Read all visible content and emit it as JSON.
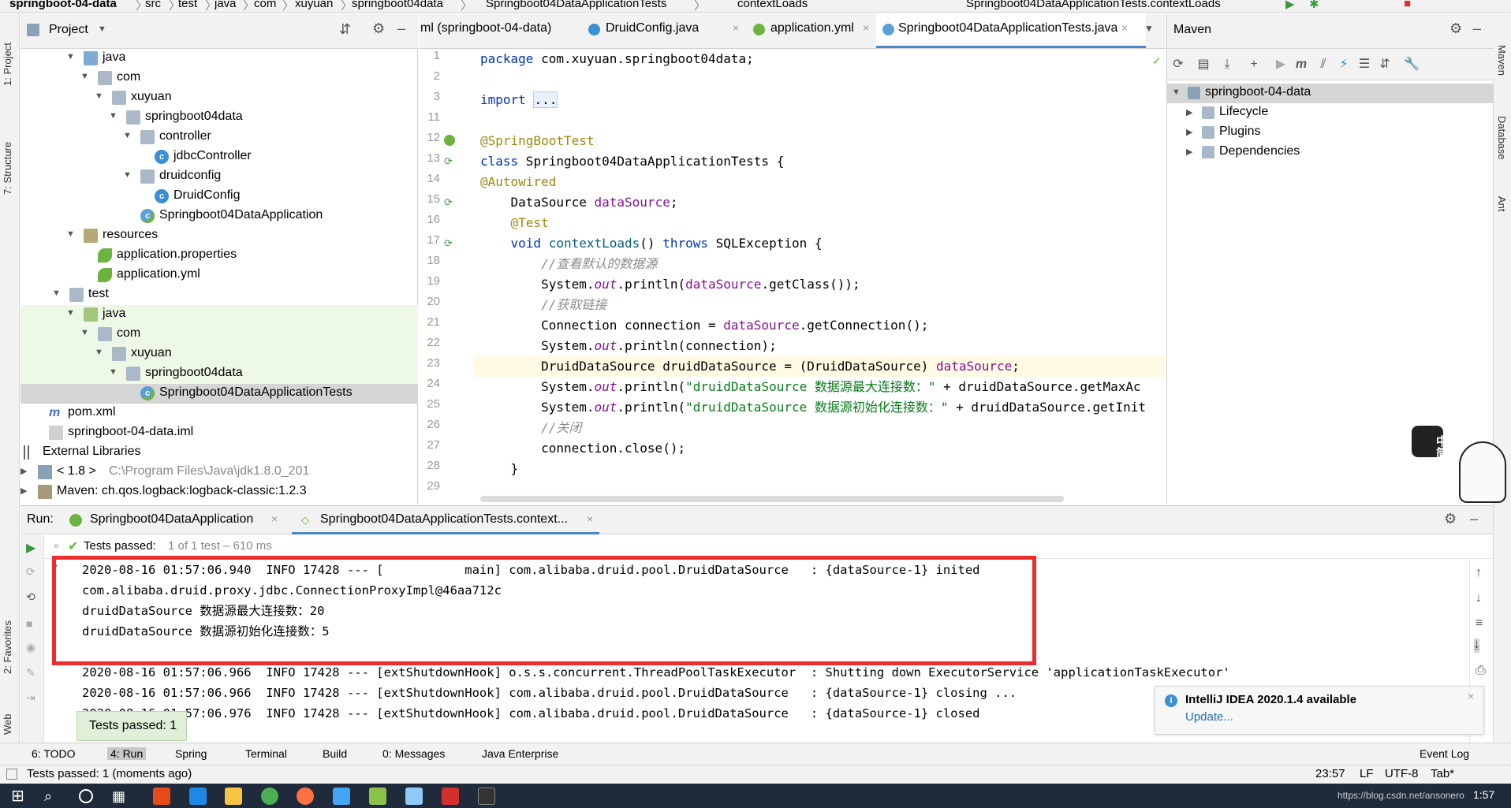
{
  "navbar": {
    "crumbs": [
      "springboot-04-data",
      "src",
      "test",
      "java",
      "com",
      "xuyuan",
      "springboot04data",
      "Springboot04DataApplicationTests",
      "contextLoads"
    ],
    "run_config": "Springboot04DataApplicationTests.contextLoads"
  },
  "left_strip": {
    "project": "1: Project",
    "structure": "7: Structure",
    "favorites": "2: Favorites",
    "web": "Web"
  },
  "right_strip": {
    "maven": "Maven",
    "database": "Database",
    "ant": "Ant"
  },
  "project": {
    "title": "Project",
    "tree": [
      {
        "label": "java",
        "icon": "folder-blue"
      },
      {
        "label": "com",
        "icon": "folder"
      },
      {
        "label": "xuyuan",
        "icon": "folder"
      },
      {
        "label": "springboot04data",
        "icon": "folder"
      },
      {
        "label": "controller",
        "icon": "folder"
      },
      {
        "label": "jdbcController",
        "icon": "class"
      },
      {
        "label": "druidconfig",
        "icon": "folder"
      },
      {
        "label": "DruidConfig",
        "icon": "class"
      },
      {
        "label": "Springboot04DataApplication",
        "icon": "spring-class"
      },
      {
        "label": "resources",
        "icon": "folder-res"
      },
      {
        "label": "application.properties",
        "icon": "spring-leaf"
      },
      {
        "label": "application.yml",
        "icon": "spring-leaf"
      },
      {
        "label": "test",
        "icon": "folder"
      },
      {
        "label": "java",
        "icon": "folder-green"
      },
      {
        "label": "com",
        "icon": "folder"
      },
      {
        "label": "xuyuan",
        "icon": "folder"
      },
      {
        "label": "springboot04data",
        "icon": "folder"
      },
      {
        "label": "Springboot04DataApplicationTests",
        "icon": "spring-class"
      },
      {
        "label": "pom.xml",
        "icon": "maven-m"
      },
      {
        "label": "springboot-04-data.iml",
        "icon": "file"
      },
      {
        "label": "External Libraries",
        "icon": "library"
      },
      {
        "label": "< 1.8 >",
        "extra": "C:\\Program Files\\Java\\jdk1.8.0_201",
        "icon": "jdk"
      },
      {
        "label": "Maven: ch.qos.logback:logback-classic:1.2.3",
        "icon": "jar"
      }
    ]
  },
  "editor": {
    "tabs": [
      "ml (springboot-04-data)",
      "DruidConfig.java",
      "application.yml",
      "Springboot04DataApplicationTests.java"
    ],
    "line_numbers": [
      "1",
      "2",
      "3",
      "11",
      "12",
      "13",
      "14",
      "15",
      "16",
      "17",
      "18",
      "19",
      "20",
      "21",
      "22",
      "23",
      "24",
      "25",
      "26",
      "27",
      "28",
      "29"
    ],
    "code": {
      "l1_kw": "package",
      "l1_rest": " com.xuyuan.springboot04data;",
      "l3_kw": "import",
      "l3_fold": "...",
      "l12": "@SpringBootTest",
      "l13_kw": "class",
      "l13_rest": " Springboot04DataApplicationTests {",
      "l14": "@Autowired",
      "l15_type": "    DataSource ",
      "l15_fld": "dataSource",
      "l15_end": ";",
      "l16": "    @Test",
      "l17_kw1": "    void ",
      "l17_fn": "contextLoads",
      "l17_mid": "() ",
      "l17_kw2": "throws",
      "l17_end": " SQLException {",
      "l18": "        //查看默认的数据源",
      "l19_a": "        System.",
      "l19_st": "out",
      "l19_b": ".println(",
      "l19_fld": "dataSource",
      "l19_c": ".getClass());",
      "l20": "        //获取链接",
      "l21_a": "        Connection connection = ",
      "l21_fld": "dataSource",
      "l21_b": ".getConnection();",
      "l22_a": "        System.",
      "l22_st": "out",
      "l22_b": ".println(connection);",
      "l23_a": "        DruidDataSource druidDataSource = (DruidDataSource) ",
      "l23_fld": "dataSource",
      "l23_b": ";",
      "l24_a": "        System.",
      "l24_st": "out",
      "l24_b": ".println(",
      "l24_str": "\"druidDataSource 数据源最大连接数：\"",
      "l24_c": " + druidDataSource.getMaxAc",
      "l25_a": "        System.",
      "l25_st": "out",
      "l25_b": ".println(",
      "l25_str": "\"druidDataSource 数据源初始化连接数：\"",
      "l25_c": " + druidDataSource.getInit",
      "l26": "        //关闭",
      "l27": "        connection.close();",
      "l28": "    }"
    }
  },
  "maven": {
    "title": "Maven",
    "root": "springboot-04-data",
    "children": [
      "Lifecycle",
      "Plugins",
      "Dependencies"
    ]
  },
  "run": {
    "label": "Run:",
    "tabs": [
      "Springboot04DataApplication",
      "Springboot04DataApplicationTests.context..."
    ],
    "passed": "Tests passed:",
    "passed_detail": "1 of 1 test – 610 ms",
    "console": [
      "2020-08-16 01:57:06.940  INFO 17428 --- [           main] com.alibaba.druid.pool.DruidDataSource   : {dataSource-1} inited",
      "com.alibaba.druid.proxy.jdbc.ConnectionProxyImpl@46aa712c",
      "druidDataSource 数据源最大连接数：20",
      "druidDataSource 数据源初始化连接数：5",
      "",
      "2020-08-16 01:57:06.966  INFO 17428 --- [extShutdownHook] o.s.s.concurrent.ThreadPoolTaskExecutor  : Shutting down ExecutorService 'applicationTaskExecutor'",
      "2020-08-16 01:57:06.966  INFO 17428 --- [extShutdownHook] com.alibaba.druid.pool.DruidDataSource   : {dataSource-1} closing ...",
      "2020-08-16 01:57:06.976  INFO 17428 --- [extShutdownHook] com.alibaba.druid.pool.DruidDataSource   : {dataSource-1} closed"
    ]
  },
  "tooltip": "Tests passed: 1",
  "notification": {
    "title": "IntelliJ IDEA 2020.1.4 available",
    "link": "Update...",
    "watermark": "https://blog.csdn.net/ansonero"
  },
  "bottom_tabs": [
    "6: TODO",
    "4: Run",
    "Spring",
    "Terminal",
    "Build",
    "0: Messages",
    "Java Enterprise",
    "Event Log"
  ],
  "status": {
    "message": "Tests passed: 1 (moments ago)",
    "position": "23:57",
    "line_sep": "LF",
    "encoding": "UTF-8",
    "indent": "Tab*"
  },
  "sticker": {
    "text": "中简半"
  },
  "taskbar": {
    "time": "1:57"
  },
  "colors": {
    "accent": "#4a88c7",
    "highlight_red": "#ee2e2e",
    "pass_green": "#5fb832"
  }
}
